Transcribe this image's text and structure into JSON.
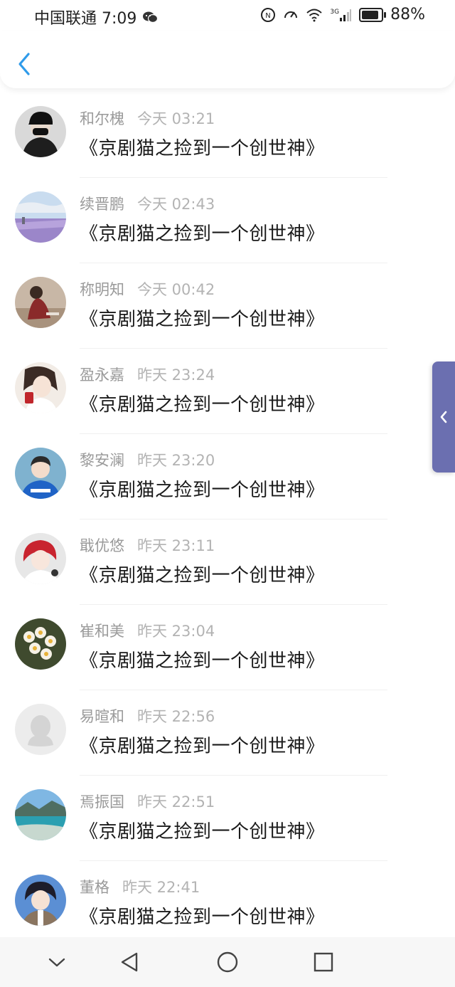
{
  "status_bar": {
    "carrier_time": "中国联通 7:09",
    "network": "3G",
    "battery": "88%",
    "battery_level": 0.88,
    "icons": [
      "wechat-icon",
      "nfc-icon",
      "speed-icon",
      "wifi-icon",
      "signal-icon",
      "battery-icon"
    ]
  },
  "header": {
    "back_icon": "chevron-left-icon",
    "accent": "#2f9bea"
  },
  "comments": [
    {
      "name": "和尔槐",
      "time": "今天 03:21",
      "text": "《京剧猫之捡到一个创世神》",
      "avatar": "avatar-dark-mask"
    },
    {
      "name": "续晋鹏",
      "time": "今天 02:43",
      "text": "《京剧猫之捡到一个创世神》",
      "avatar": "avatar-lavender-field"
    },
    {
      "name": "称明知",
      "time": "今天 00:42",
      "text": "《京剧猫之捡到一个创世神》",
      "avatar": "avatar-girl-sitting"
    },
    {
      "name": "盈永嘉",
      "time": "昨天 23:24",
      "text": "《京剧猫之捡到一个创世神》",
      "avatar": "avatar-girl-red-card"
    },
    {
      "name": "黎安澜",
      "time": "昨天 23:20",
      "text": "《京剧猫之捡到一个创世神》",
      "avatar": "avatar-boy-blue-hoodie"
    },
    {
      "name": "戢优悠",
      "time": "昨天 23:11",
      "text": "《京剧猫之捡到一个创世神》",
      "avatar": "avatar-anime-red-hair"
    },
    {
      "name": "崔和美",
      "time": "昨天 23:04",
      "text": "《京剧猫之捡到一个创世神》",
      "avatar": "avatar-flowers"
    },
    {
      "name": "易暄和",
      "time": "昨天 22:56",
      "text": "《京剧猫之捡到一个创世神》",
      "avatar": "avatar-default"
    },
    {
      "name": "焉振国",
      "time": "昨天 22:51",
      "text": "《京剧猫之捡到一个创世神》",
      "avatar": "avatar-lake"
    },
    {
      "name": "董格",
      "time": "昨天 22:41",
      "text": "《京剧猫之捡到一个创世神》",
      "avatar": "avatar-anime-boy"
    }
  ],
  "side_tab": {
    "icon": "chevron-left-icon",
    "color": "#6b6fb0"
  },
  "nav_bar": {
    "icons": [
      "chevron-down-icon",
      "back-triangle-icon",
      "home-circle-icon",
      "recents-square-icon"
    ]
  }
}
